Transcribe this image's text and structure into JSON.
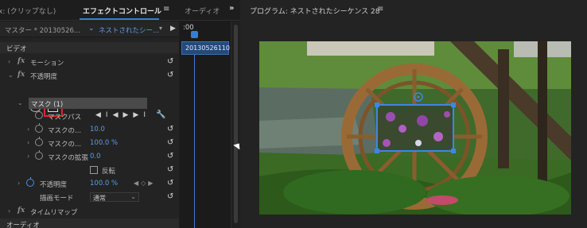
{
  "tabs": {
    "source": "x: (クリップなし)",
    "effect_controls": "エフェクトコントロール",
    "audio": "オーディオ",
    "menu_glyph": "≡",
    "overflow_glyph": "»"
  },
  "effect_controls": {
    "master_label": "マスター * 20130526...",
    "sequence_label": "ネストされたシー...",
    "timeline": {
      "time_partial": ":00",
      "clip_label": "20130526110"
    },
    "sections": {
      "video": "ビデオ",
      "audio": "オーディオ"
    },
    "effects": {
      "motion": "モーション",
      "opacity": "不透明度",
      "time_remap": "タイムリマップ"
    },
    "mask": {
      "name": "マスク (1)",
      "path_label": "マスクパス",
      "feather_label": "マスクの...",
      "feather_value": "10.0",
      "opacity_label": "マスクの...",
      "opacity_value": "100.0 %",
      "expansion_label": "マスクの拡張",
      "expansion_value": "0.0",
      "inverted_label": "反転",
      "inverted_checked": false
    },
    "opacity_prop": {
      "label": "不透明度",
      "value": "100.0 %"
    },
    "blend_mode": {
      "label": "描画モード",
      "value": "通常"
    }
  },
  "program_monitor": {
    "title": "プログラム: ネストされたシーケンス 28",
    "menu_glyph": "≡"
  },
  "icons": {
    "motion_fx": "fx",
    "reset": "reset-icon",
    "pen": "pen-icon",
    "wrench": "wrench-icon"
  },
  "colors": {
    "accent_blue": "#3b7bd4",
    "value_blue": "#5a9cec",
    "highlight_red": "#e3242b",
    "mask_outline": "#3d86e8"
  }
}
